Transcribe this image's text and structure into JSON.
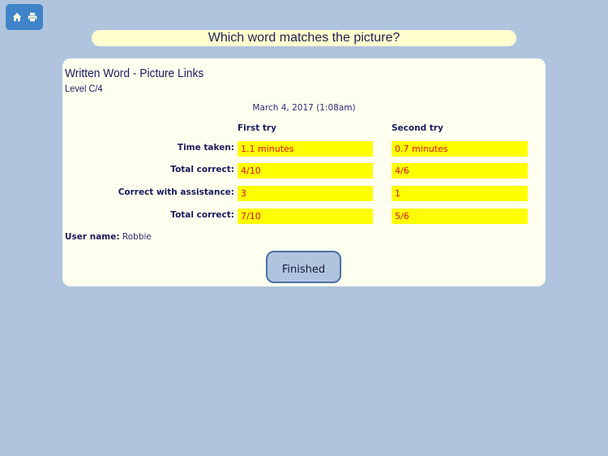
{
  "toolbar": {
    "home_icon": "home-icon",
    "print_icon": "printer-icon"
  },
  "question": "Which word matches the picture?",
  "report": {
    "title": "Written Word - Picture Links",
    "level": "Level C/4",
    "date": "March 4, 2017 (1:08am)",
    "columns": [
      "First try",
      "Second try"
    ],
    "rows": [
      {
        "label": "Time taken:",
        "first": "1.1 minutes",
        "second": "0.7 minutes"
      },
      {
        "label": "Total correct:",
        "first": "4/10",
        "second": "4/6"
      },
      {
        "label": "Correct with assistance:",
        "first": "3",
        "second": "1"
      },
      {
        "label": "Total correct:",
        "first": "7/10",
        "second": "5/6"
      }
    ],
    "user_label": "User name:",
    "user_name": "Robbie",
    "finished_label": "Finished"
  },
  "colors": {
    "background": "#b0c4de",
    "toolbar": "#3f83c8",
    "value_highlight": "#ffff00",
    "value_text": "#e01010"
  }
}
